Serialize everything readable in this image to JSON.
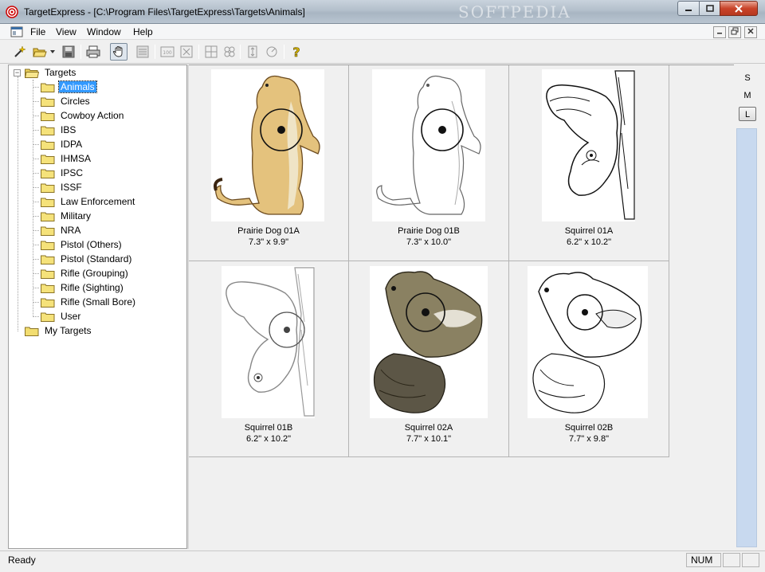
{
  "window": {
    "title": "TargetExpress - [C:\\Program Files\\TargetExpress\\Targets\\Animals]",
    "watermark": "SOFTPEDIA"
  },
  "menu": {
    "items": [
      "File",
      "View",
      "Window",
      "Help"
    ]
  },
  "toolbar": {
    "icons": [
      "new-target-icon",
      "open-icon",
      "save-icon",
      "print-icon",
      "hand-icon",
      "list-icon",
      "zoom-100-icon",
      "fit-icon",
      "grid-2x2-icon",
      "grid-4-icon",
      "height-icon",
      "rotate-icon",
      "help-icon"
    ]
  },
  "tree": {
    "root": "Targets",
    "children": [
      "Animals",
      "Circles",
      "Cowboy Action",
      "IBS",
      "IDPA",
      "IHMSA",
      "IPSC",
      "ISSF",
      "Law Enforcement",
      "Military",
      "NRA",
      "Pistol (Others)",
      "Pistol (Standard)",
      "Rifle (Grouping)",
      "Rifle (Sighting)",
      "Rifle (Small Bore)",
      "User"
    ],
    "selected": "Animals",
    "second_root": "My Targets"
  },
  "targets": [
    {
      "name": "Prairie Dog 01A",
      "size": "7.3\" x 9.9\""
    },
    {
      "name": "Prairie Dog 01B",
      "size": "7.3\" x 10.0\""
    },
    {
      "name": "Squirrel 01A",
      "size": "6.2\" x 10.2\""
    },
    {
      "name": "Squirrel 01B",
      "size": "6.2\" x 10.2\""
    },
    {
      "name": "Squirrel 02A",
      "size": "7.7\" x 10.1\""
    },
    {
      "name": "Squirrel 02B",
      "size": "7.7\" x 9.8\""
    }
  ],
  "size_selector": {
    "options": [
      "S",
      "M",
      "L"
    ],
    "selected": "L"
  },
  "statusbar": {
    "status": "Ready",
    "num": "NUM"
  },
  "colors": {
    "selection": "#3399ff",
    "folder": "#f5e27a",
    "slider_track": "#c8d9ef"
  }
}
